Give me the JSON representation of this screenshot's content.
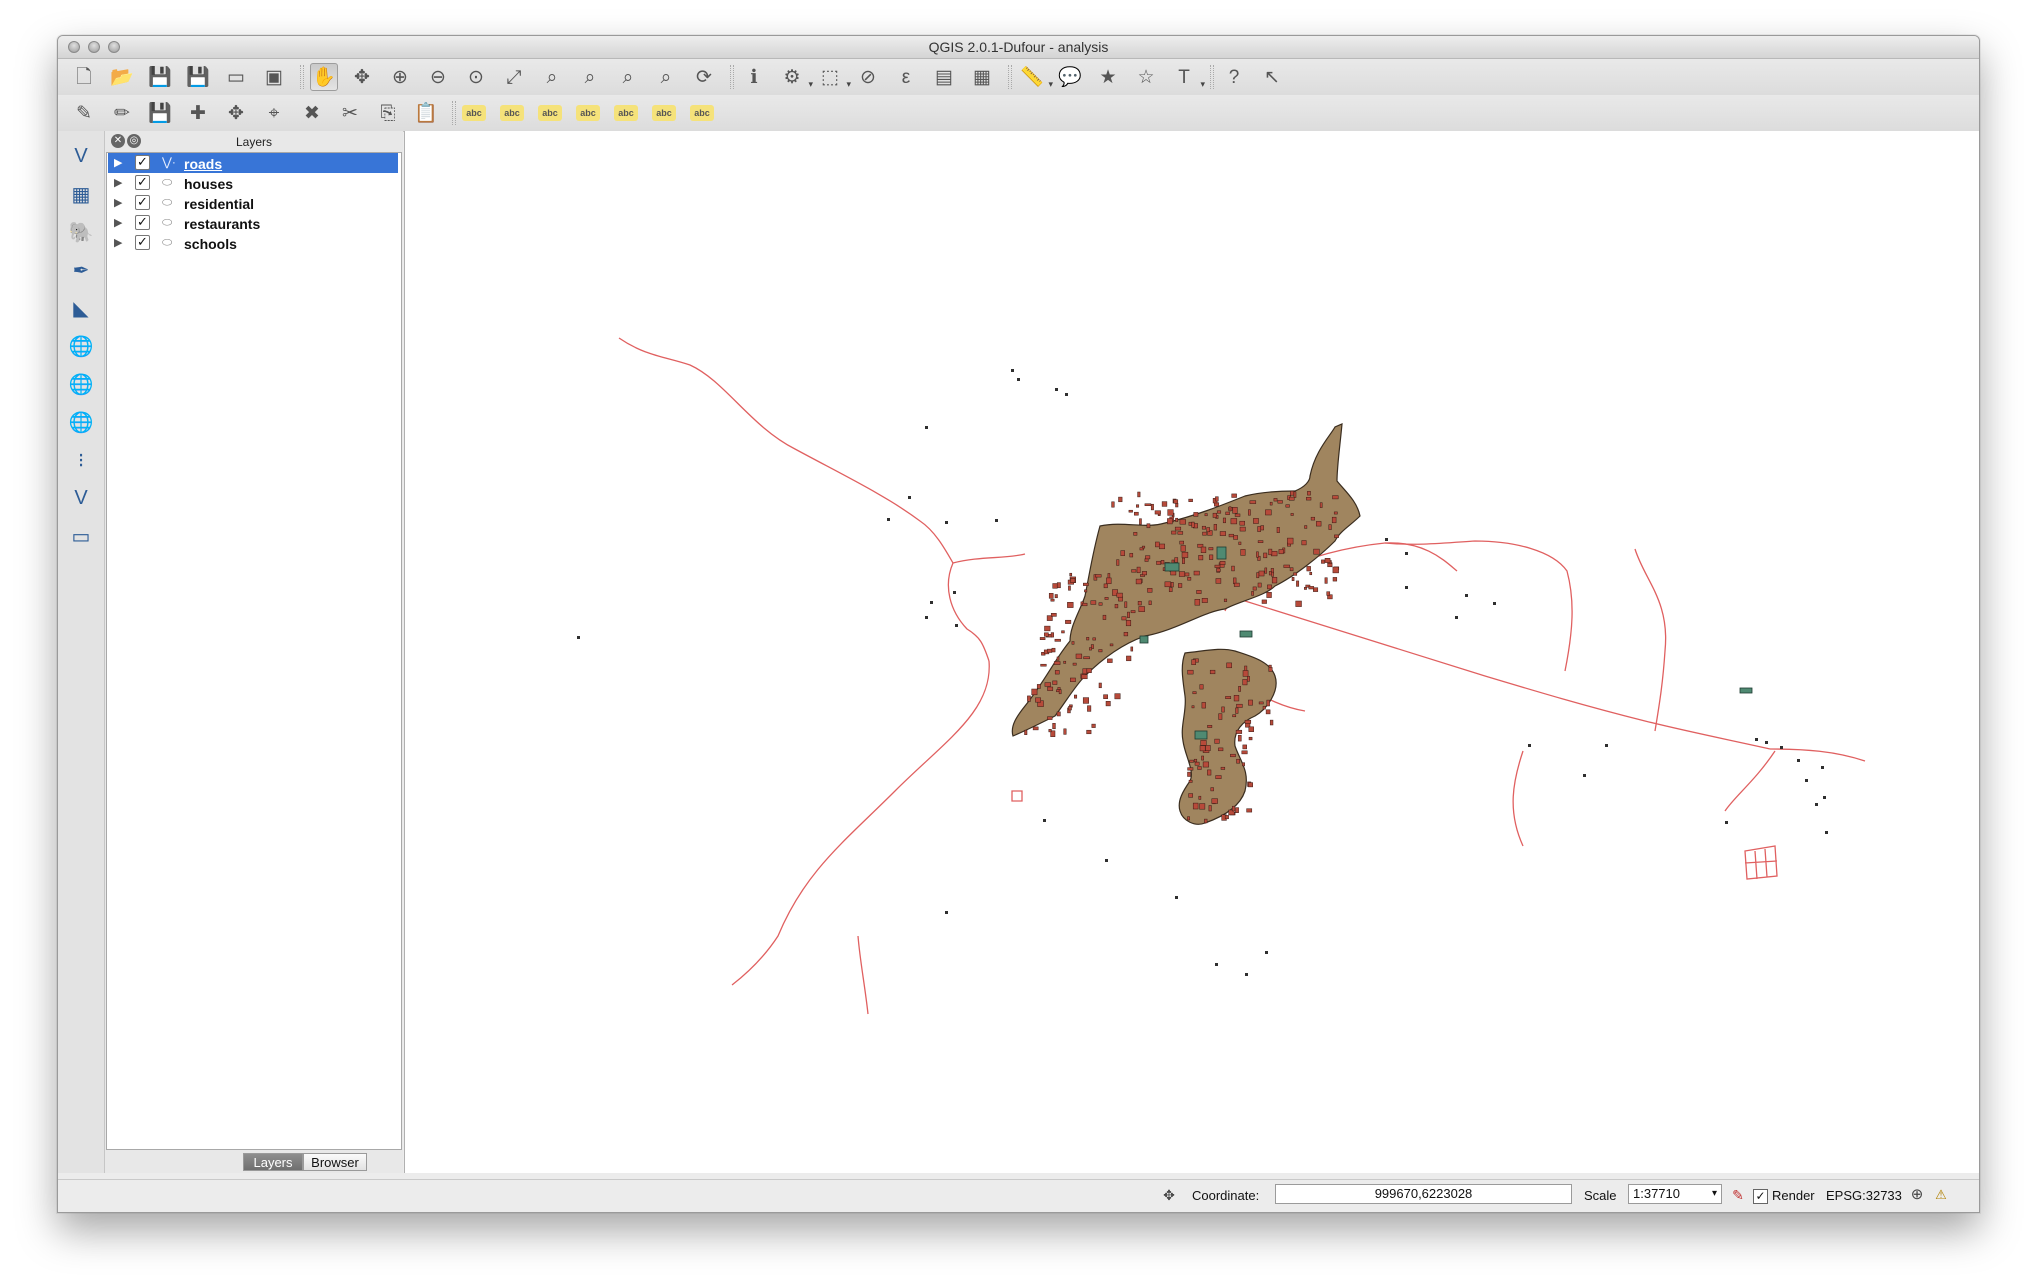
{
  "window": {
    "title": "QGIS 2.0.1-Dufour - analysis"
  },
  "toolbar_top": [
    {
      "name": "new-project-icon",
      "glyph": "🗋"
    },
    {
      "name": "open-project-icon",
      "glyph": "📂"
    },
    {
      "name": "save-project-icon",
      "glyph": "💾"
    },
    {
      "name": "save-as-icon",
      "glyph": "💾"
    },
    {
      "name": "new-print-composer-icon",
      "glyph": "▭"
    },
    {
      "name": "composer-manager-icon",
      "glyph": "▣"
    },
    {
      "name": "pan-map-icon",
      "glyph": "✋"
    },
    {
      "name": "pan-to-selection-icon",
      "glyph": "✥"
    },
    {
      "name": "zoom-in-icon",
      "glyph": "⊕"
    },
    {
      "name": "zoom-out-icon",
      "glyph": "⊖"
    },
    {
      "name": "zoom-actual-size-icon",
      "glyph": "⊙"
    },
    {
      "name": "zoom-full-icon",
      "glyph": "⤢"
    },
    {
      "name": "zoom-to-selection-icon",
      "glyph": "⌕"
    },
    {
      "name": "zoom-to-layer-icon",
      "glyph": "⌕"
    },
    {
      "name": "zoom-last-icon",
      "glyph": "⌕"
    },
    {
      "name": "zoom-next-icon",
      "glyph": "⌕"
    },
    {
      "name": "refresh-icon",
      "glyph": "⟳"
    },
    {
      "name": "identify-icon",
      "glyph": "ℹ"
    },
    {
      "name": "action-icon",
      "glyph": "⚙"
    },
    {
      "name": "select-features-icon",
      "glyph": "⬚"
    },
    {
      "name": "deselect-features-icon",
      "glyph": "⊘"
    },
    {
      "name": "select-by-expression-icon",
      "glyph": "ε"
    },
    {
      "name": "attribute-table-icon",
      "glyph": "▤"
    },
    {
      "name": "field-calculator-icon",
      "glyph": "▦"
    },
    {
      "name": "measure-icon",
      "glyph": "📏"
    },
    {
      "name": "map-tips-icon",
      "glyph": "💬"
    },
    {
      "name": "new-bookmark-icon",
      "glyph": "★"
    },
    {
      "name": "show-bookmarks-icon",
      "glyph": "☆"
    },
    {
      "name": "text-annotation-icon",
      "glyph": "T"
    },
    {
      "name": "help-contents-icon",
      "glyph": "?"
    },
    {
      "name": "whats-this-icon",
      "glyph": "↖"
    }
  ],
  "toolbar_second": [
    {
      "name": "current-edits-icon",
      "glyph": "✎"
    },
    {
      "name": "toggle-editing-icon",
      "glyph": "✏"
    },
    {
      "name": "save-layer-edits-icon",
      "glyph": "💾"
    },
    {
      "name": "add-feature-icon",
      "glyph": "✚"
    },
    {
      "name": "move-feature-icon",
      "glyph": "✥"
    },
    {
      "name": "node-tool-icon",
      "glyph": "⌖"
    },
    {
      "name": "delete-selected-icon",
      "glyph": "✖"
    },
    {
      "name": "cut-features-icon",
      "glyph": "✂"
    },
    {
      "name": "copy-features-icon",
      "glyph": "⎘"
    },
    {
      "name": "paste-features-icon",
      "glyph": "📋"
    },
    {
      "name": "labeling-icon",
      "glyph": "abc"
    },
    {
      "name": "pin-labels-icon",
      "glyph": "abc"
    },
    {
      "name": "highlight-pinned-labels-icon",
      "glyph": "abc"
    },
    {
      "name": "show-hide-labels-icon",
      "glyph": "abc"
    },
    {
      "name": "move-label-icon",
      "glyph": "abc"
    },
    {
      "name": "rotate-label-icon",
      "glyph": "abc"
    },
    {
      "name": "change-label-icon",
      "glyph": "abc"
    }
  ],
  "left_toolbar": [
    {
      "name": "add-vector-layer-icon",
      "glyph": "V"
    },
    {
      "name": "add-raster-layer-icon",
      "glyph": "▦"
    },
    {
      "name": "add-postgis-layer-icon",
      "glyph": "🐘"
    },
    {
      "name": "add-spatialite-layer-icon",
      "glyph": "✒"
    },
    {
      "name": "add-mssql-layer-icon",
      "glyph": "◣"
    },
    {
      "name": "add-wms-layer-icon",
      "glyph": "🌐"
    },
    {
      "name": "add-wcs-layer-icon",
      "glyph": "🌐"
    },
    {
      "name": "add-wfs-layer-icon",
      "glyph": "🌐"
    },
    {
      "name": "add-delimited-text-layer-icon",
      "glyph": "⁝"
    },
    {
      "name": "new-shapefile-layer-icon",
      "glyph": "V"
    },
    {
      "name": "remove-layer-icon",
      "glyph": "▭"
    }
  ],
  "layers_panel": {
    "title": "Layers",
    "layers": [
      {
        "name": "roads",
        "checked": true,
        "selected": true,
        "type": "line"
      },
      {
        "name": "houses",
        "checked": true,
        "selected": false,
        "type": "polygon"
      },
      {
        "name": "residential",
        "checked": true,
        "selected": false,
        "type": "polygon"
      },
      {
        "name": "restaurants",
        "checked": true,
        "selected": false,
        "type": "polygon"
      },
      {
        "name": "schools",
        "checked": true,
        "selected": false,
        "type": "polygon"
      }
    ],
    "tabs": [
      "Layers",
      "Browser"
    ],
    "active_tab": "Layers"
  },
  "statusbar": {
    "coordinate_label": "Coordinate:",
    "coordinate_value": "999670,6223028",
    "scale_label": "Scale",
    "scale_value": "1:37710",
    "render_label": "Render",
    "render_checked": true,
    "crs": "EPSG:32733"
  },
  "colors": {
    "road": "#e06060",
    "residential_fill": "#a0855f",
    "house_fill": "#b74a3a",
    "school_fill": "#4f8a72",
    "selection": "#3875d7"
  }
}
